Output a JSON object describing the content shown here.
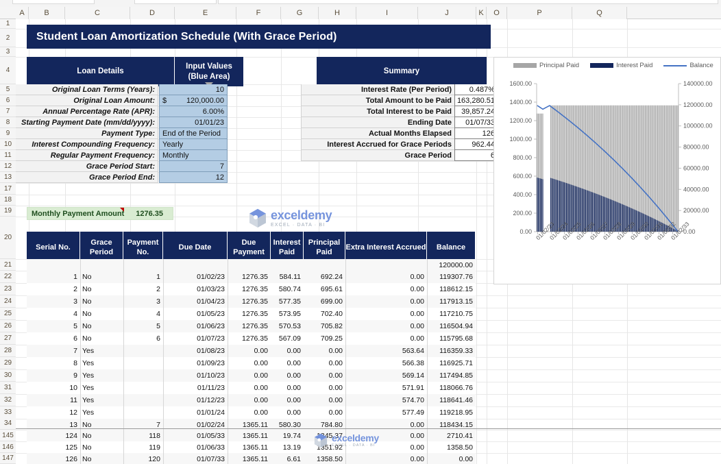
{
  "workbook": {
    "columns": [
      "A",
      "B",
      "C",
      "D",
      "E",
      "F",
      "G",
      "H",
      "I",
      "J",
      "K",
      "O",
      "P",
      "Q"
    ],
    "rows": [
      "1",
      "2",
      "3",
      "4",
      "5",
      "6",
      "7",
      "8",
      "9",
      "10",
      "11",
      "12",
      "13",
      "17",
      "18",
      "19",
      "20",
      "21",
      "22",
      "23",
      "24",
      "25",
      "26",
      "27",
      "28",
      "29",
      "30",
      "31",
      "32",
      "33",
      "34",
      "145",
      "146",
      "147"
    ]
  },
  "title": "Student Loan Amortization Schedule (With Grace Period)",
  "loan_details": {
    "header_left": "Loan Details",
    "header_right_line1": "Input Values",
    "header_right_line2": "(Blue Area)",
    "rows": [
      {
        "label": "Original Loan Terms (Years):",
        "value": "10",
        "align": "right",
        "currency": ""
      },
      {
        "label": "Original Loan Amount:",
        "value": "120,000.00",
        "align": "currency",
        "currency": "$"
      },
      {
        "label": "Annual Percentage Rate (APR):",
        "value": "6.00%",
        "align": "right",
        "currency": ""
      },
      {
        "label": "Starting Payment Date (mm/dd/yyyy):",
        "value": "01/01/23",
        "align": "right",
        "currency": ""
      },
      {
        "label": "Payment Type:",
        "value": "End of the Period",
        "align": "left",
        "currency": ""
      },
      {
        "label": "Interest Compounding Frequency:",
        "value": "Yearly",
        "align": "left",
        "currency": ""
      },
      {
        "label": "Regular Payment Frequency:",
        "value": "Monthly",
        "align": "left",
        "currency": ""
      },
      {
        "label": "Grace Period Start:",
        "value": "7",
        "align": "right",
        "currency": ""
      },
      {
        "label": "Grace Period End:",
        "value": "12",
        "align": "right",
        "currency": ""
      }
    ]
  },
  "summary": {
    "header": "Summary",
    "rows": [
      {
        "label": "Interest Rate (Per Period)",
        "value": "0.487%"
      },
      {
        "label": "Total Amount to be Paid",
        "value": "163,280.51"
      },
      {
        "label": "Total Interest to be Paid",
        "value": "39,857.24"
      },
      {
        "label": "Ending Date",
        "value": "01/07/33"
      },
      {
        "label": "Actual Months Elapsed",
        "value": "126"
      },
      {
        "label": "Interest Accrued for Grace Periods",
        "value": "962.44"
      },
      {
        "label": "Grace Period",
        "value": "6"
      }
    ]
  },
  "monthly_payment": {
    "label": "Monthly Payment Amount",
    "value": "1276.35"
  },
  "amortization": {
    "headers": [
      "Serial No.",
      "Grace Period",
      "Payment No.",
      "Due Date",
      "Due Payment",
      "Interest Paid",
      "Principal Paid",
      "Extra Interest Accrued",
      "Balance"
    ],
    "opening_row": {
      "serial": "",
      "grace": "",
      "payment_no": "",
      "due_date": "",
      "due_payment": "",
      "interest_paid": "",
      "principal_paid": "",
      "extra_interest": "",
      "balance": "120000.00"
    },
    "rows": [
      {
        "serial": "1",
        "grace": "No",
        "payment_no": "1",
        "due_date": "01/02/23",
        "due_payment": "1276.35",
        "interest_paid": "584.11",
        "principal_paid": "692.24",
        "extra_interest": "0.00",
        "balance": "119307.76"
      },
      {
        "serial": "2",
        "grace": "No",
        "payment_no": "2",
        "due_date": "01/03/23",
        "due_payment": "1276.35",
        "interest_paid": "580.74",
        "principal_paid": "695.61",
        "extra_interest": "0.00",
        "balance": "118612.15"
      },
      {
        "serial": "3",
        "grace": "No",
        "payment_no": "3",
        "due_date": "01/04/23",
        "due_payment": "1276.35",
        "interest_paid": "577.35",
        "principal_paid": "699.00",
        "extra_interest": "0.00",
        "balance": "117913.15"
      },
      {
        "serial": "4",
        "grace": "No",
        "payment_no": "4",
        "due_date": "01/05/23",
        "due_payment": "1276.35",
        "interest_paid": "573.95",
        "principal_paid": "702.40",
        "extra_interest": "0.00",
        "balance": "117210.75"
      },
      {
        "serial": "5",
        "grace": "No",
        "payment_no": "5",
        "due_date": "01/06/23",
        "due_payment": "1276.35",
        "interest_paid": "570.53",
        "principal_paid": "705.82",
        "extra_interest": "0.00",
        "balance": "116504.94"
      },
      {
        "serial": "6",
        "grace": "No",
        "payment_no": "6",
        "due_date": "01/07/23",
        "due_payment": "1276.35",
        "interest_paid": "567.09",
        "principal_paid": "709.25",
        "extra_interest": "0.00",
        "balance": "115795.68"
      },
      {
        "serial": "7",
        "grace": "Yes",
        "payment_no": "",
        "due_date": "01/08/23",
        "due_payment": "0.00",
        "interest_paid": "0.00",
        "principal_paid": "0.00",
        "extra_interest": "563.64",
        "balance": "116359.33"
      },
      {
        "serial": "8",
        "grace": "Yes",
        "payment_no": "",
        "due_date": "01/09/23",
        "due_payment": "0.00",
        "interest_paid": "0.00",
        "principal_paid": "0.00",
        "extra_interest": "566.38",
        "balance": "116925.71"
      },
      {
        "serial": "9",
        "grace": "Yes",
        "payment_no": "",
        "due_date": "01/10/23",
        "due_payment": "0.00",
        "interest_paid": "0.00",
        "principal_paid": "0.00",
        "extra_interest": "569.14",
        "balance": "117494.85"
      },
      {
        "serial": "10",
        "grace": "Yes",
        "payment_no": "",
        "due_date": "01/11/23",
        "due_payment": "0.00",
        "interest_paid": "0.00",
        "principal_paid": "0.00",
        "extra_interest": "571.91",
        "balance": "118066.76"
      },
      {
        "serial": "11",
        "grace": "Yes",
        "payment_no": "",
        "due_date": "01/12/23",
        "due_payment": "0.00",
        "interest_paid": "0.00",
        "principal_paid": "0.00",
        "extra_interest": "574.70",
        "balance": "118641.46"
      },
      {
        "serial": "12",
        "grace": "Yes",
        "payment_no": "",
        "due_date": "01/01/24",
        "due_payment": "0.00",
        "interest_paid": "0.00",
        "principal_paid": "0.00",
        "extra_interest": "577.49",
        "balance": "119218.95"
      },
      {
        "serial": "13",
        "grace": "No",
        "payment_no": "7",
        "due_date": "01/02/24",
        "due_payment": "1365.11",
        "interest_paid": "580.30",
        "principal_paid": "784.80",
        "extra_interest": "0.00",
        "balance": "118434.15"
      }
    ],
    "rows_bottom": [
      {
        "serial": "124",
        "grace": "No",
        "payment_no": "118",
        "due_date": "01/05/33",
        "due_payment": "1365.11",
        "interest_paid": "19.74",
        "principal_paid": "1345.37",
        "extra_interest": "0.00",
        "balance": "2710.41"
      },
      {
        "serial": "125",
        "grace": "No",
        "payment_no": "119",
        "due_date": "01/06/33",
        "due_payment": "1365.11",
        "interest_paid": "13.19",
        "principal_paid": "1351.92",
        "extra_interest": "0.00",
        "balance": "1358.50"
      },
      {
        "serial": "126",
        "grace": "No",
        "payment_no": "120",
        "due_date": "01/07/33",
        "due_payment": "1365.11",
        "interest_paid": "6.61",
        "principal_paid": "1358.50",
        "extra_interest": "0.00",
        "balance": "0.00"
      }
    ]
  },
  "watermark": {
    "name": "exceldemy",
    "tagline": "EXCEL · DATA · BI"
  },
  "chart_data": {
    "type": "bar",
    "title": "",
    "legend": [
      {
        "name": "Principal Paid",
        "color": "#A6A6A6",
        "kind": "bar"
      },
      {
        "name": "Interest Paid",
        "color": "#13265C",
        "kind": "bar"
      },
      {
        "name": "Balance",
        "color": "#4472C4",
        "kind": "line"
      }
    ],
    "legend_position": "top",
    "grid": false,
    "xlabel": "",
    "ylabel": "",
    "y_left_label": "",
    "y_right_label": "",
    "ylim": [
      0,
      1600
    ],
    "y2lim": [
      0,
      140000
    ],
    "yticks": [
      "0.00",
      "200.00",
      "400.00",
      "600.00",
      "800.00",
      "1000.00",
      "1200.00",
      "1400.00",
      "1600.00"
    ],
    "y2ticks": [
      "0.00",
      "20000.00",
      "40000.00",
      "60000.00",
      "80000.00",
      "100000.00",
      "120000.00",
      "140000.00"
    ],
    "xticks": [
      "01/02/23",
      "01/02/24",
      "01/02/25",
      "01/02/26",
      "01/02/27",
      "01/02/28",
      "01/02/29",
      "01/02/30",
      "01/02/31",
      "01/02/32",
      "01/02/33"
    ],
    "series": [
      {
        "name": "Principal Paid",
        "axis": "left",
        "type": "bar",
        "values": [
          692.24,
          0,
          0,
          0,
          0,
          0,
          784.8,
          1345.37,
          1351.92,
          1358.5
        ]
      },
      {
        "name": "Interest Paid",
        "axis": "left",
        "type": "bar",
        "values": [
          584.11,
          0,
          0,
          0,
          0,
          0,
          580.3,
          19.74,
          13.19,
          6.61
        ]
      },
      {
        "name": "Balance",
        "axis": "right",
        "type": "line",
        "values": [
          120000,
          115795.68,
          119218.95,
          118434.15,
          100000,
          80000,
          60000,
          40000,
          20000,
          2710.41,
          0
        ]
      }
    ]
  }
}
